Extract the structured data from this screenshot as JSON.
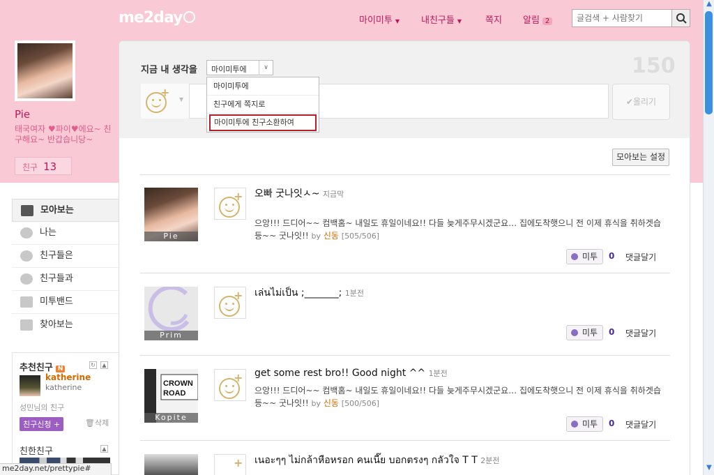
{
  "header": {
    "logo": "me2day",
    "nav": [
      {
        "label": "마이미투",
        "has_menu": true
      },
      {
        "label": "내친구들",
        "has_menu": true
      },
      {
        "label": "쪽지",
        "has_menu": false
      },
      {
        "label": "알림",
        "has_menu": false,
        "badge": "2"
      }
    ],
    "search_placeholder": "글검색 + 사람찾기"
  },
  "profile": {
    "name": "Pie",
    "desc": "태국여자 ♥파이♥에요~ 친구해요~ 반갑습니당~",
    "friend_label": "친구",
    "friend_count": "13"
  },
  "sidebar": {
    "items": [
      {
        "label": "모아보는",
        "icon": "collection-icon"
      },
      {
        "label": "나는",
        "icon": "speech-bubble-icon"
      },
      {
        "label": "친구들은",
        "icon": "friends-bubble-icon"
      },
      {
        "label": "친구들과",
        "icon": "chat-bubble-icon"
      },
      {
        "label": "미투밴드",
        "icon": "band-icon"
      },
      {
        "label": "찾아보는",
        "icon": "star-icon"
      }
    ]
  },
  "recommend": {
    "title": "추천친구",
    "badge": "N",
    "user_name": "katherine",
    "user_id": "katherine",
    "sub": "성민님의 친구",
    "add_button": "친구신청 +",
    "delete": "삭제",
    "close_title": "친한친구"
  },
  "composer": {
    "label": "지금 내 생각을",
    "select_value": "마이미투에",
    "options": [
      "마이미투에",
      "친구에게 쪽지로",
      "마이미투에 친구소환하여"
    ],
    "counter": "150",
    "post_button": "올리기"
  },
  "feed_settings": "모아보는 설정",
  "posts": [
    {
      "avatar_label": "Pie",
      "title": "오빠 굿나잇ㅅ~",
      "time": "지금막",
      "body": "으앙!!! 드디어~~ 컴백홈~ 내일도 휴일이네요!! 다들 늦게주무시겠군요… 집에도착햇으니 전 이제 휴식을 취하겟습등~~ 굿나잇!!",
      "by": "by",
      "author": "신동",
      "count": "[505/506]",
      "metoo": "미투",
      "metoo_count": "0",
      "reply": "댓글달기"
    },
    {
      "avatar_label": "Prim",
      "title": "เล่นไม่เป็น ;_______;",
      "time": "1분전",
      "body": "",
      "by": "",
      "author": "",
      "count": "",
      "metoo": "미투",
      "metoo_count": "0",
      "reply": "댓글달기"
    },
    {
      "avatar_label": "Kopite",
      "title": "get some rest bro!! Good night ^^",
      "time": "1분전",
      "body": "으앙!!! 드디어~~ 컴백홈~ 내일도 휴일이네요!! 다들 늦게주무시겠군요… 집에도착햇으니 전 이제 휴식을 취하겟습등~~ 굿나잇!!",
      "by": "by",
      "author": "신동",
      "count": "[500/506]",
      "metoo": "미투",
      "metoo_count": "0",
      "reply": "댓글달기"
    },
    {
      "avatar_label": "",
      "title": "เนอะๆๆ ไม่กล้าหือหรอก คนเนี๊ย บอกตรงๆ กลัวใจ T T",
      "time": "2분전",
      "body": "",
      "by": "",
      "author": "",
      "count": "",
      "metoo": "",
      "metoo_count": "",
      "reply": ""
    }
  ],
  "statusbar": "me2day.net/prettypie#"
}
